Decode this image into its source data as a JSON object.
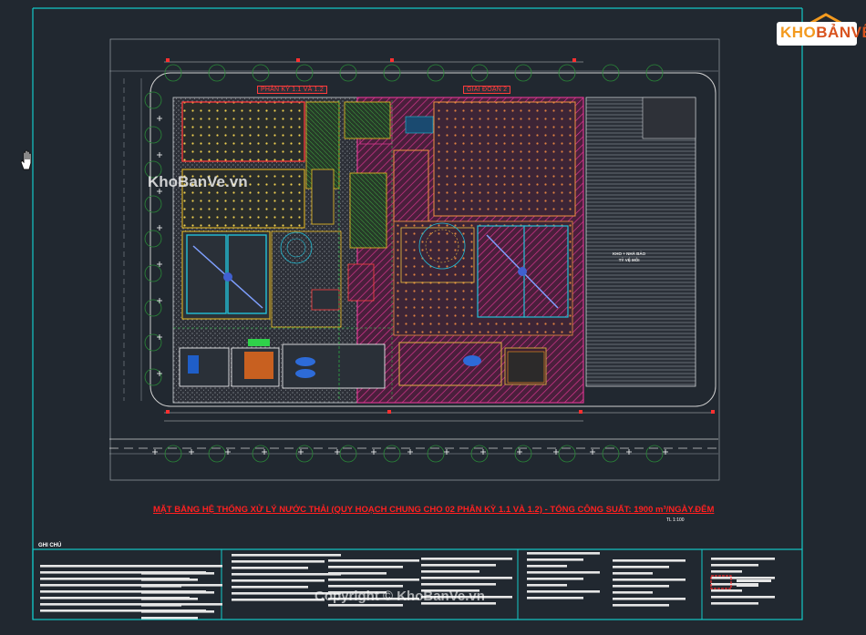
{
  "drawing": {
    "title": "MẶT BẰNG HỆ THỐNG XỬ LÝ NƯỚC THẢI (QUY HOẠCH CHUNG CHO 02 PHÂN KỲ 1.1 VÀ 1.2) - TỔNG CÔNG SUẤT: 1900 m³/NGÀY.ĐÊM",
    "scale": "TL 1:100",
    "phase_label_1": "PHÂN KỲ 1.1 VÀ 1.2",
    "phase_label_2": "GIAI ĐOẠN 2",
    "warehouse_label": "KHO + NHÀ BẢO",
    "warehouse_label_2": "TỶ VỆ MÔI",
    "notes_title": "GHI CHÚ"
  },
  "watermarks": {
    "overlay": "KhoBanVe.vn",
    "copyright": "Copyright © KhoBanVe.vn"
  },
  "logo": {
    "text_a": "KHO",
    "text_b": "BẢNVẼ",
    "color": "#f39a1e"
  },
  "colors": {
    "background": "#212830",
    "frame": "#13c7c7",
    "site_outline": "#d0d0d0",
    "phase1": "#f0c020",
    "phase2_hatch": "#d8368f",
    "tanks": "#22c0d8",
    "equipment": "#ff4040",
    "greenery": "#2fd24a"
  },
  "icons": {
    "cursor": "hand-cursor-icon",
    "tree": "tree-icon",
    "lamp": "street-light-icon"
  }
}
